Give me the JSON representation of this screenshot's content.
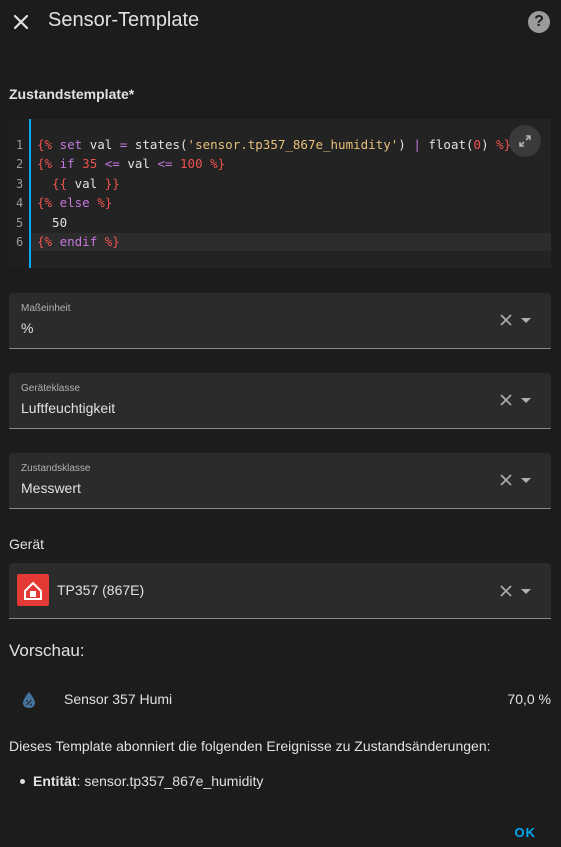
{
  "dialog": {
    "title": "Sensor-Template"
  },
  "template": {
    "label": "Zustandstemplate*",
    "line_numbers": [
      "1",
      "2",
      "3",
      "4",
      "5",
      "6"
    ],
    "lines": [
      [
        {
          "t": "{%",
          "c": "tag"
        },
        {
          "t": " set ",
          "c": "kw"
        },
        {
          "t": "val",
          "c": "txt"
        },
        {
          "t": " = ",
          "c": "op"
        },
        {
          "t": "states(",
          "c": "txt"
        },
        {
          "t": "'sensor.tp357_867e_humidity'",
          "c": "str"
        },
        {
          "t": ") ",
          "c": "txt"
        },
        {
          "t": "|",
          "c": "op"
        },
        {
          "t": " float(",
          "c": "txt"
        },
        {
          "t": "0",
          "c": "num"
        },
        {
          "t": ") ",
          "c": "txt"
        },
        {
          "t": "%}",
          "c": "tag"
        }
      ],
      [
        {
          "t": "{%",
          "c": "tag"
        },
        {
          "t": " if ",
          "c": "kw"
        },
        {
          "t": "35",
          "c": "num"
        },
        {
          "t": " <= ",
          "c": "op"
        },
        {
          "t": "val",
          "c": "txt"
        },
        {
          "t": " <= ",
          "c": "op"
        },
        {
          "t": "100",
          "c": "num"
        },
        {
          "t": " %}",
          "c": "tag"
        }
      ],
      [
        {
          "t": "  {{",
          "c": "tag"
        },
        {
          "t": " val ",
          "c": "txt"
        },
        {
          "t": "}}",
          "c": "tag"
        }
      ],
      [
        {
          "t": "{%",
          "c": "tag"
        },
        {
          "t": " else ",
          "c": "kw"
        },
        {
          "t": "%}",
          "c": "tag"
        }
      ],
      [
        {
          "t": "  50",
          "c": "txt"
        }
      ],
      [
        {
          "t": "{%",
          "c": "tag"
        },
        {
          "t": " endif ",
          "c": "kw"
        },
        {
          "t": "%}",
          "c": "tag"
        }
      ]
    ]
  },
  "fields": {
    "unit": {
      "label": "Maßeinheit",
      "value": "%"
    },
    "device_class": {
      "label": "Geräteklasse",
      "value": "Luftfeuchtigkeit"
    },
    "state_class": {
      "label": "Zustandsklasse",
      "value": "Messwert"
    }
  },
  "device": {
    "label": "Gerät",
    "name": "TP357 (867E)"
  },
  "preview": {
    "title": "Vorschau:",
    "entity_name": "Sensor 357 Humi",
    "entity_state": "70,0 %",
    "subscribe_text": "Dieses Template abonniert die folgenden Ereignisse zu Zustandsänderungen:",
    "entity_prefix": "Entität",
    "entity_id": ": sensor.tp357_867e_humidity"
  },
  "actions": {
    "ok_label": "OK"
  },
  "colors": {
    "accent": "#03a9f4",
    "background": "#1c1c1c",
    "device_icon": "#e53935"
  }
}
